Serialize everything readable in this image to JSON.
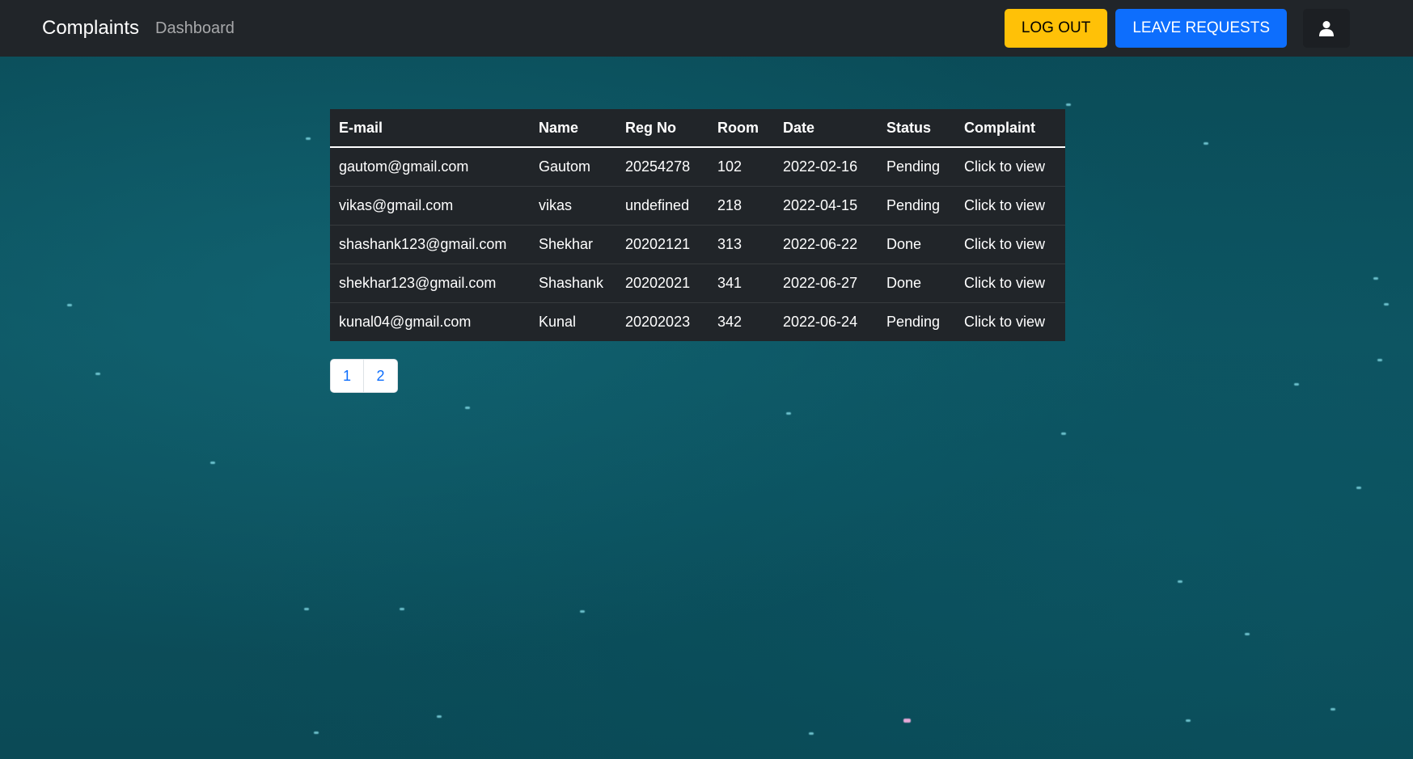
{
  "navbar": {
    "brand": "Complaints",
    "dashboard_link": "Dashboard",
    "logout_label": "LOG OUT",
    "leave_requests_label": "LEAVE REQUESTS",
    "user_icon": "user-icon"
  },
  "table": {
    "headers": [
      "E-mail",
      "Name",
      "Reg No",
      "Room",
      "Date",
      "Status",
      "Complaint"
    ],
    "rows": [
      {
        "email": "gautom@gmail.com",
        "name": "Gautom",
        "reg_no": "20254278",
        "room": "102",
        "date": "2022-02-16",
        "status": "Pending",
        "complaint": "Click to view"
      },
      {
        "email": "vikas@gmail.com",
        "name": "vikas",
        "reg_no": "undefined",
        "room": "218",
        "date": "2022-04-15",
        "status": "Pending",
        "complaint": "Click to view"
      },
      {
        "email": "shashank123@gmail.com",
        "name": "Shekhar",
        "reg_no": "20202121",
        "room": "313",
        "date": "2022-06-22",
        "status": "Done",
        "complaint": "Click to view"
      },
      {
        "email": "shekhar123@gmail.com",
        "name": "Shashank",
        "reg_no": "20202021",
        "room": "341",
        "date": "2022-06-27",
        "status": "Done",
        "complaint": "Click to view"
      },
      {
        "email": "kunal04@gmail.com",
        "name": "Kunal",
        "reg_no": "20202023",
        "room": "342",
        "date": "2022-06-24",
        "status": "Pending",
        "complaint": "Click to view"
      }
    ]
  },
  "pagination": {
    "pages": [
      "1",
      "2"
    ]
  },
  "colors": {
    "navbar_bg": "#212529",
    "warning": "#ffc107",
    "primary": "#0d6efd",
    "table_bg": "#212529"
  }
}
